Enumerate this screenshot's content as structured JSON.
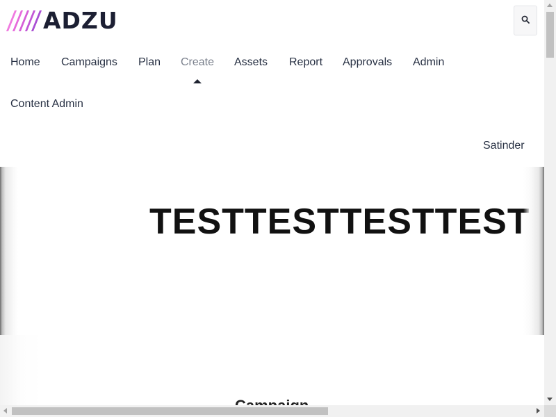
{
  "header": {
    "logo_text": "ADZU",
    "logo_stripe_colors": [
      "#f07be0",
      "#e66bdc",
      "#d65fd8",
      "#c257d6",
      "#a94fd3"
    ],
    "search_icon": "search-icon"
  },
  "nav": {
    "items": [
      {
        "label": "Home",
        "active": false
      },
      {
        "label": "Campaigns",
        "active": false
      },
      {
        "label": "Plan",
        "active": false
      },
      {
        "label": "Create",
        "active": true
      },
      {
        "label": "Assets",
        "active": false
      },
      {
        "label": "Report",
        "active": false
      },
      {
        "label": "Approvals",
        "active": false
      },
      {
        "label": "Admin",
        "active": false
      },
      {
        "label": "Content Admin",
        "active": false
      }
    ],
    "user_name": "Satinder"
  },
  "hero": {
    "title": "TESTTESTTESTTESTTEST"
  },
  "main": {
    "section_heading": "Campaign"
  },
  "colors": {
    "text": "#1f2330",
    "nav_active": "#7a808c",
    "logo_text": "#1c1f33"
  }
}
